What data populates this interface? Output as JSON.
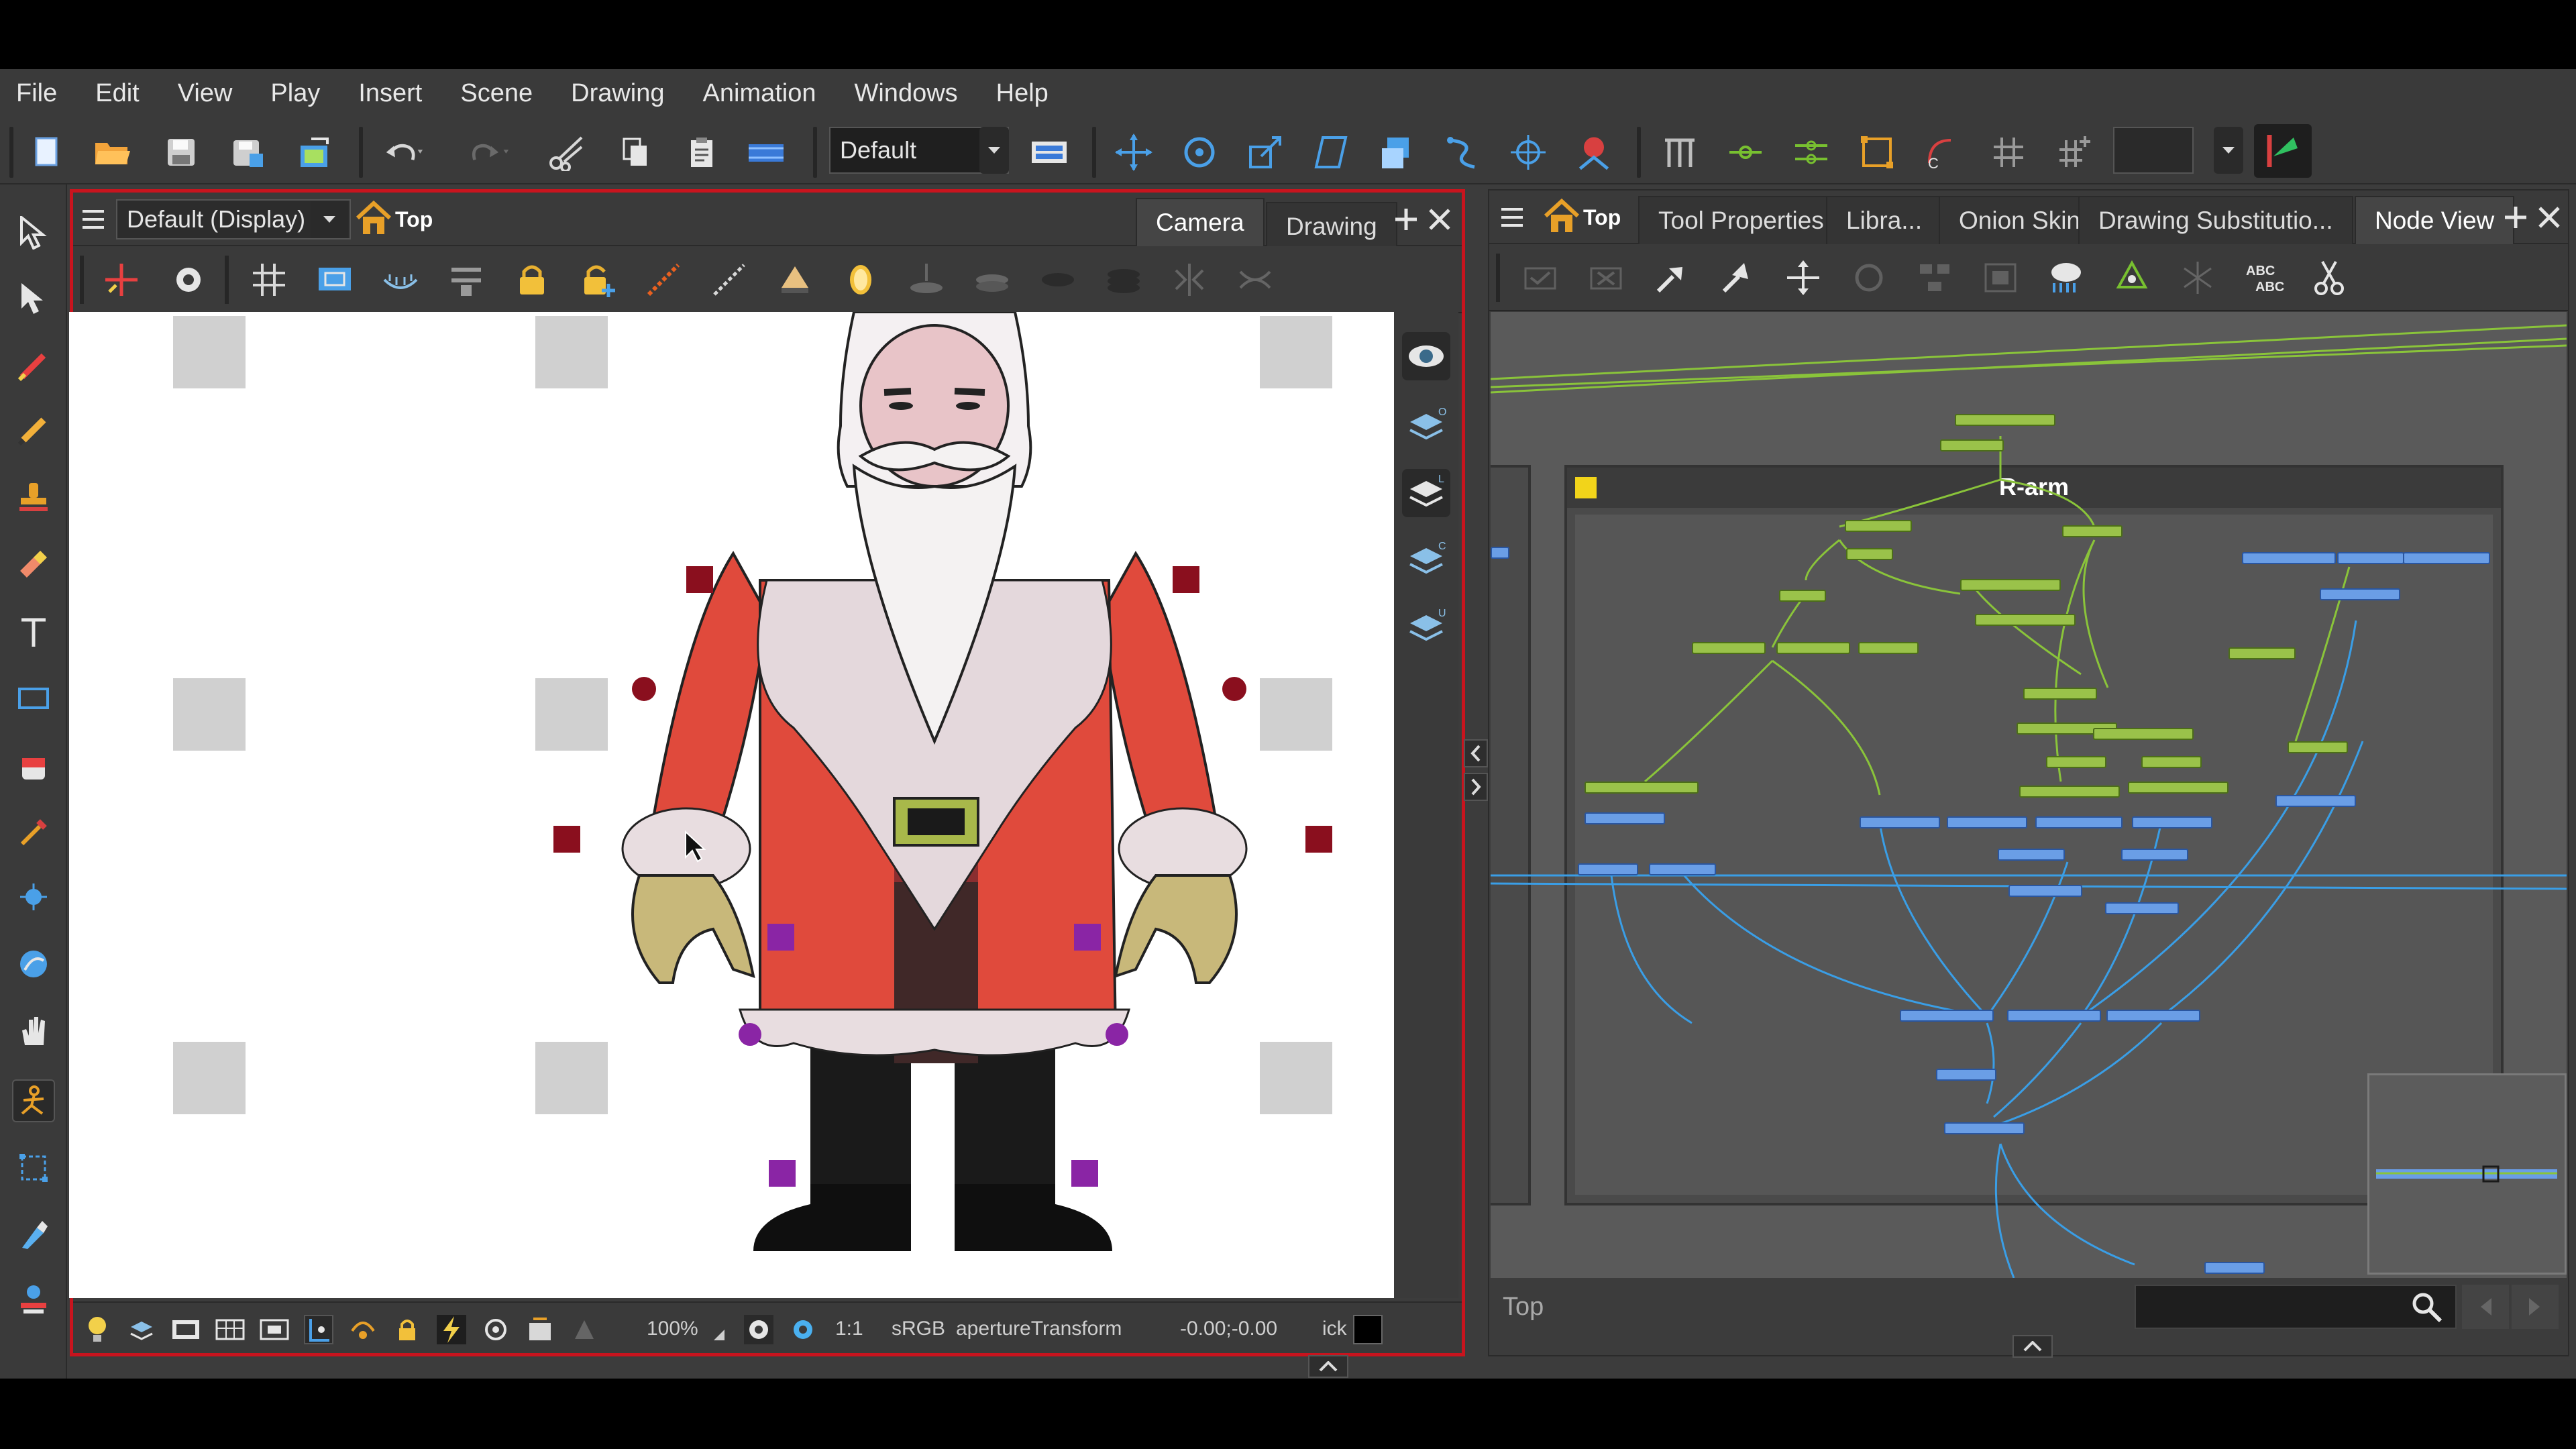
{
  "menu": [
    "File",
    "Edit",
    "View",
    "Play",
    "Insert",
    "Scene",
    "Drawing",
    "Animation",
    "Windows",
    "Help"
  ],
  "toolbar": {
    "workspace_value": "Default"
  },
  "camera_panel": {
    "view_mode_value": "Default (Display)",
    "breadcrumb": "Top",
    "tabs": [
      "Camera",
      "Drawing"
    ],
    "status": {
      "zoom": "100%",
      "ratio": "1:1",
      "color_space": "sRGB",
      "transform": "apertureTransform",
      "coords": "-0.00;-0.00",
      "trailing": "ick"
    },
    "layer_rail_letters": [
      "O",
      "L",
      "C",
      "U"
    ]
  },
  "node_panel": {
    "breadcrumb": "Top",
    "tabs": [
      "Tool Properties",
      "Libra...",
      "Onion Skin",
      "Drawing Substitutio...",
      "Node View"
    ],
    "active_tab": "Node View",
    "group_title": "R-arm",
    "footer_path": "Top"
  },
  "colors": {
    "accent_red": "#c8141e",
    "peg_node": "#9ac24a",
    "module_node": "#6a9ee6",
    "cable_green": "#8ac43a",
    "cable_blue": "#3a9ee6"
  }
}
